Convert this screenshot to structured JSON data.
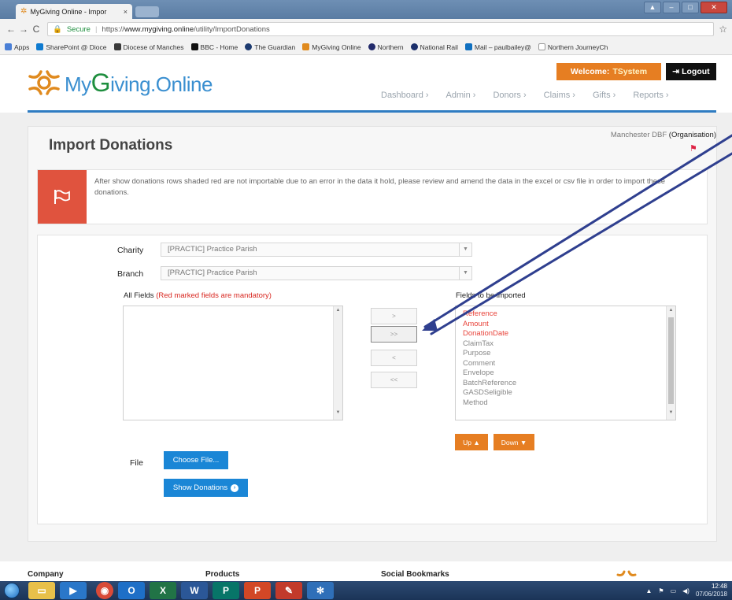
{
  "browser": {
    "tab_title": "MyGiving Online - Impor",
    "tab_close": "×",
    "url_secure_label": "Secure",
    "url_scheme": "https://",
    "url_host": "www.mygiving.online",
    "url_path": "/utility/ImportDonations",
    "bookmarks": [
      {
        "label": "Apps",
        "icon_color": "#4a7fd6"
      },
      {
        "label": "SharePoint @ Dioce",
        "icon_color": "#0f7bd0"
      },
      {
        "label": "Diocese of Manches",
        "icon_color": "#3a3a3a"
      },
      {
        "label": "BBC - Home",
        "icon_color": "#111111"
      },
      {
        "label": "The Guardian",
        "icon_color": "#1d3b70"
      },
      {
        "label": "MyGiving Online",
        "icon_color": "#e08a1e"
      },
      {
        "label": "Northern",
        "icon_color": "#222a6b"
      },
      {
        "label": "National Rail",
        "icon_color": "#1b2f6b"
      },
      {
        "label": "Mail – paulbailey@",
        "icon_color": "#1070c0"
      },
      {
        "label": "Northern JourneyCh",
        "icon_color": "#dddddd"
      }
    ]
  },
  "header": {
    "logo_my": "My",
    "logo_g": "G",
    "logo_rest": "iving",
    "logo_dot": ".",
    "logo_online": "Online",
    "welcome_label": "Welcome:",
    "welcome_user": "TSystem",
    "logout_label": "Logout",
    "nav": [
      {
        "label": "Dashboard ›"
      },
      {
        "label": "Admin ›"
      },
      {
        "label": "Donors ›"
      },
      {
        "label": "Claims ›"
      },
      {
        "label": "Gifts ›"
      },
      {
        "label": "Reports ›"
      }
    ]
  },
  "page": {
    "title": "Import Donations",
    "organisation": "Manchester DBF",
    "organisation_type": "(Organisation)",
    "alert_text": "After show donations rows shaded red are not importable due to an error in the data it hold, please review and amend the data in the excel or csv file in order to import these donations."
  },
  "form": {
    "charity_label": "Charity",
    "charity_value": "[PRACTIC] Practice Parish",
    "branch_label": "Branch",
    "branch_value": "[PRACTIC] Practice Parish",
    "all_fields_label": "All Fields",
    "all_fields_note": "(Red marked fields are mandatory)",
    "to_import_label": "Fields to be imported",
    "fields": [
      {
        "name": "Reference",
        "mandatory": true
      },
      {
        "name": "Amount",
        "mandatory": true
      },
      {
        "name": "DonationDate",
        "mandatory": true
      },
      {
        "name": "ClaimTax",
        "mandatory": false
      },
      {
        "name": "Purpose",
        "mandatory": false
      },
      {
        "name": "Comment",
        "mandatory": false
      },
      {
        "name": "Envelope",
        "mandatory": false
      },
      {
        "name": "BatchReference",
        "mandatory": false
      },
      {
        "name": "GASDSeligible",
        "mandatory": false
      },
      {
        "name": "Method",
        "mandatory": false
      }
    ],
    "move_one_right": ">",
    "move_all_right": ">>",
    "move_one_left": "<",
    "move_all_left": "<<",
    "up_label": "Up ▲",
    "down_label": "Down ▼",
    "file_label": "File",
    "choose_file_label": "Choose File...",
    "show_donations_label": "Show Donations"
  },
  "footer": {
    "col1": "Company",
    "col2": "Products",
    "col3": "Social Bookmarks"
  },
  "taskbar": {
    "clock_time": "12:48",
    "clock_date": "07/06/2018",
    "apps": [
      {
        "icon": "folder-icon",
        "color": "#e8c04a",
        "glyph": "▭"
      },
      {
        "icon": "media-player-icon",
        "color": "#2a77c9",
        "glyph": "▶"
      },
      {
        "icon": "chrome-icon",
        "color": "#d94a38",
        "glyph": "◉"
      },
      {
        "icon": "outlook-icon",
        "color": "#1e6fc7",
        "glyph": "O"
      },
      {
        "icon": "excel-icon",
        "color": "#217346",
        "glyph": "X"
      },
      {
        "icon": "word-icon",
        "color": "#2b5797",
        "glyph": "W"
      },
      {
        "icon": "publisher-icon",
        "color": "#077568",
        "glyph": "P"
      },
      {
        "icon": "powerpoint-icon",
        "color": "#d24726",
        "glyph": "P"
      },
      {
        "icon": "paint-icon",
        "color": "#c23a2b",
        "glyph": "✎"
      },
      {
        "icon": "snipping-tool-icon",
        "color": "#2f6fb8",
        "glyph": "✻"
      }
    ]
  },
  "colors": {
    "brand_blue": "#2f7cc2",
    "accent_orange": "#e67e22",
    "alert_red": "#e0533e",
    "mandatory_red": "#e8433a",
    "button_blue": "#1a86d6"
  }
}
